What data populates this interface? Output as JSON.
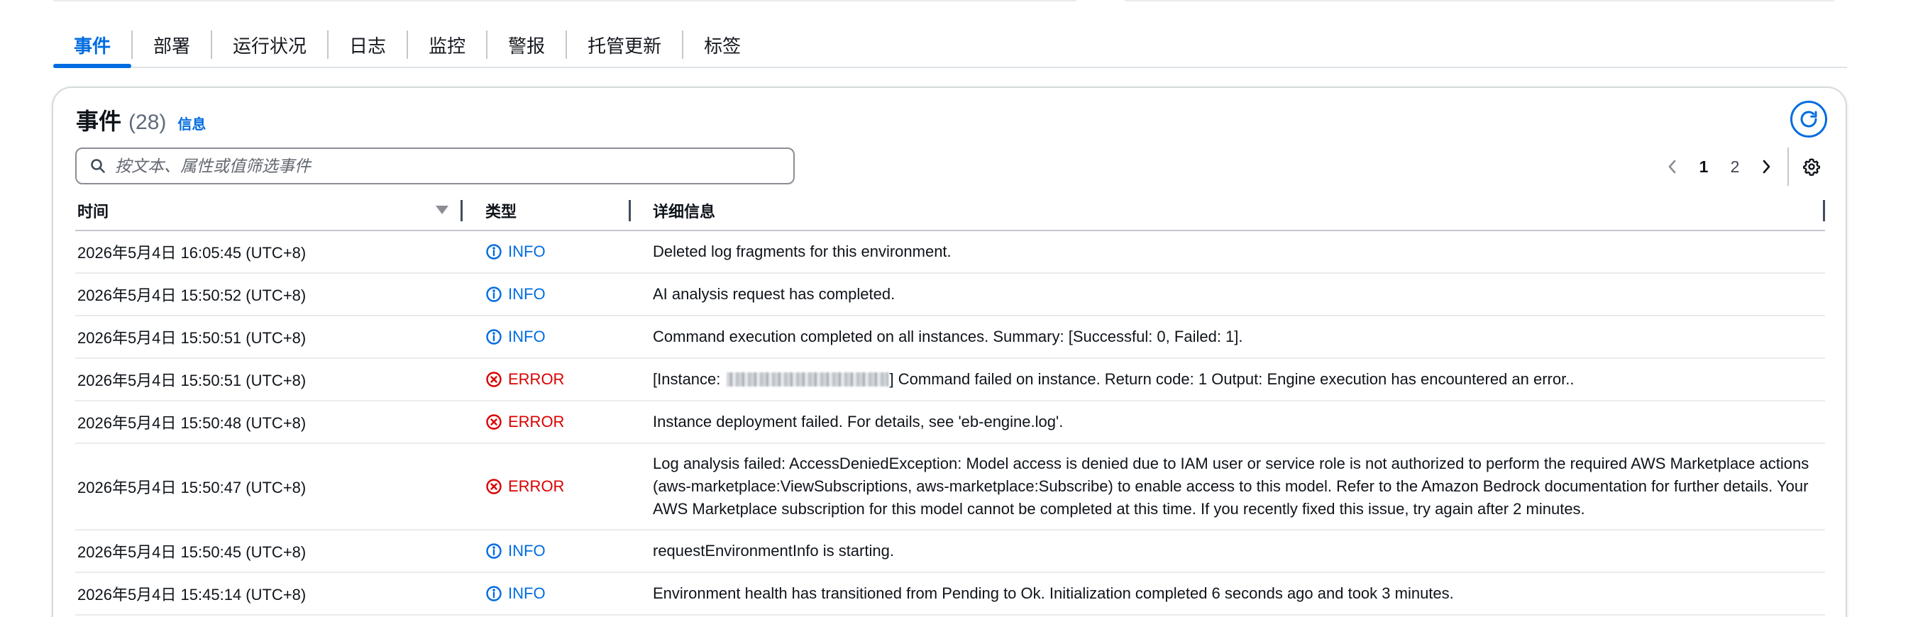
{
  "tabs": [
    {
      "label": "事件",
      "active": true
    },
    {
      "label": "部署",
      "active": false
    },
    {
      "label": "运行状况",
      "active": false
    },
    {
      "label": "日志",
      "active": false
    },
    {
      "label": "监控",
      "active": false
    },
    {
      "label": "警报",
      "active": false
    },
    {
      "label": "托管更新",
      "active": false
    },
    {
      "label": "标签",
      "active": false
    }
  ],
  "panel": {
    "title": "事件",
    "count": "(28)",
    "info_link": "信息"
  },
  "search": {
    "placeholder": "按文本、属性或值筛选事件",
    "value": ""
  },
  "pagination": {
    "pages": [
      "1",
      "2"
    ],
    "current": "1"
  },
  "columns": {
    "time": "时间",
    "type": "类型",
    "detail": "详细信息"
  },
  "rows": [
    {
      "time": "2026年5月4日 16:05:45 (UTC+8)",
      "type": "INFO",
      "detail": "Deleted log fragments for this environment."
    },
    {
      "time": "2026年5月4日 15:50:52 (UTC+8)",
      "type": "INFO",
      "detail": "AI analysis request has completed."
    },
    {
      "time": "2026年5月4日 15:50:51 (UTC+8)",
      "type": "INFO",
      "detail": "Command execution completed on all instances. Summary: [Successful: 0, Failed: 1]."
    },
    {
      "time": "2026年5月4日 15:50:51 (UTC+8)",
      "type": "ERROR",
      "detail_prefix": "[Instance: ",
      "detail_suffix": "] Command failed on instance. Return code: 1 Output: Engine execution has encountered an error.."
    },
    {
      "time": "2026年5月4日 15:50:48 (UTC+8)",
      "type": "ERROR",
      "detail": "Instance deployment failed. For details, see 'eb-engine.log'."
    },
    {
      "time": "2026年5月4日 15:50:47 (UTC+8)",
      "type": "ERROR",
      "detail": "Log analysis failed: AccessDeniedException: Model access is denied due to IAM user or service role is not authorized to perform the required AWS Marketplace actions (aws-marketplace:ViewSubscriptions, aws-marketplace:Subscribe) to enable access to this model. Refer to the Amazon Bedrock documentation for further details. Your AWS Marketplace subscription for this model cannot be completed at this time. If you recently fixed this issue, try again after 2 minutes."
    },
    {
      "time": "2026年5月4日 15:50:45 (UTC+8)",
      "type": "INFO",
      "detail": "requestEnvironmentInfo is starting."
    },
    {
      "time": "2026年5月4日 15:45:14 (UTC+8)",
      "type": "INFO",
      "detail": "Environment health has transitioned from Pending to Ok. Initialization completed 6 seconds ago and took 3 minutes."
    }
  ],
  "colors": {
    "accent": "#006ce0",
    "error": "#db0000",
    "text": "#0f141a",
    "border": "#d5dbdb"
  },
  "icons": {
    "info": "info-circle-icon",
    "error": "error-circle-x-icon",
    "search": "search-icon",
    "refresh": "refresh-icon",
    "prev": "chevron-left-icon",
    "next": "chevron-right-icon",
    "settings": "gear-icon",
    "sort": "sort-caret-icon"
  }
}
